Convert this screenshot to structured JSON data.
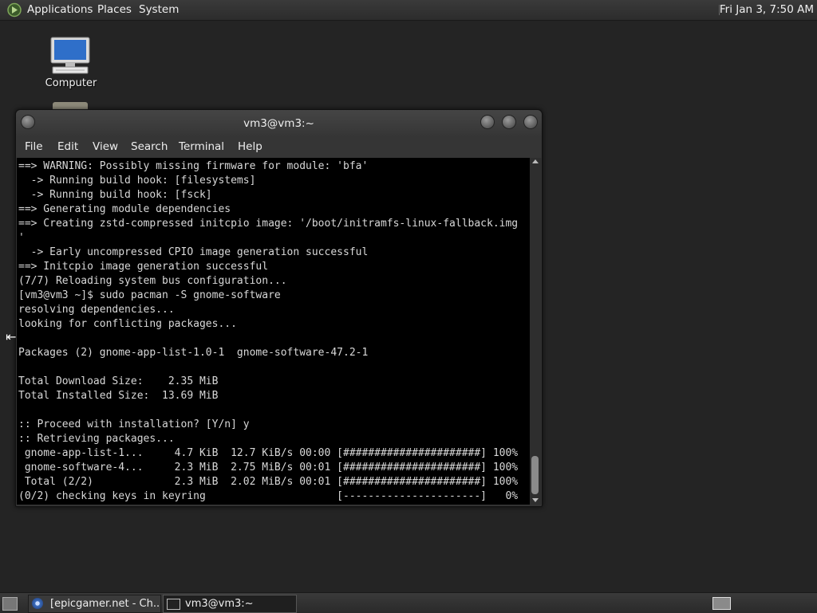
{
  "top_panel": {
    "applications": "Applications",
    "places": "Places",
    "system": "System",
    "clock": "Fri Jan  3,  7:50 AM"
  },
  "desktop": {
    "computer_label": "Computer"
  },
  "terminal_window": {
    "title": "vm3@vm3:~",
    "menu": {
      "file": "File",
      "edit": "Edit",
      "view": "View",
      "search": "Search",
      "terminal": "Terminal",
      "help": "Help"
    },
    "content": "==> WARNING: Possibly missing firmware for module: 'bfa'\n  -> Running build hook: [filesystems]\n  -> Running build hook: [fsck]\n==> Generating module dependencies\n==> Creating zstd-compressed initcpio image: '/boot/initramfs-linux-fallback.img\n'\n  -> Early uncompressed CPIO image generation successful\n==> Initcpio image generation successful\n(7/7) Reloading system bus configuration...\n[vm3@vm3 ~]$ sudo pacman -S gnome-software\nresolving dependencies...\nlooking for conflicting packages...\n\nPackages (2) gnome-app-list-1.0-1  gnome-software-47.2-1\n\nTotal Download Size:    2.35 MiB\nTotal Installed Size:  13.69 MiB\n\n:: Proceed with installation? [Y/n] y\n:: Retrieving packages...\n gnome-app-list-1...     4.7 KiB  12.7 KiB/s 00:00 [######################] 100%\n gnome-software-4...     2.3 MiB  2.75 MiB/s 00:01 [######################] 100%\n Total (2/2)             2.3 MiB  2.02 MiB/s 00:01 [######################] 100%\n(0/2) checking keys in keyring                     [----------------------]   0%"
  },
  "taskbar": {
    "items": [
      {
        "label": "[epicgamer.net - Ch...",
        "icon": "browser-icon"
      },
      {
        "label": "vm3@vm3:~",
        "icon": "terminal-icon"
      }
    ]
  },
  "colors": {
    "desktop_bg": "#242424",
    "panel_bg": "#333333",
    "terminal_bg": "#000000",
    "terminal_fg": "#d8d8d8"
  }
}
